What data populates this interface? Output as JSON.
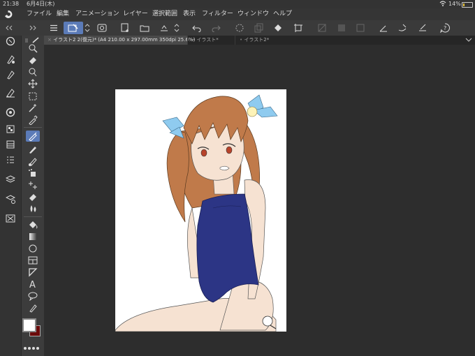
{
  "status": {
    "time": "21:38",
    "date": "6月4日(木)",
    "battery": "14%"
  },
  "menu": {
    "items": [
      "ファイル",
      "編集",
      "アニメーション",
      "レイヤー",
      "選択範囲",
      "表示",
      "フィルター",
      "ウィンドウ",
      "ヘルプ"
    ]
  },
  "tabs": [
    {
      "label": "イラスト2 2(復元)* (A4 210.00 x 297.00mm 350dpi 25.6%)",
      "active": true
    },
    {
      "label": "イラスト*",
      "active": false
    },
    {
      "label": "イラスト2*",
      "active": false
    }
  ],
  "colors": {
    "main": "#ffffff",
    "sub": "#6b0a0a",
    "accent": "#5b7bb8",
    "hair": "#c07a4a",
    "swimsuit": "#2c3585",
    "skin": "#f6e2d2",
    "ribbon": "#8fcbef"
  }
}
